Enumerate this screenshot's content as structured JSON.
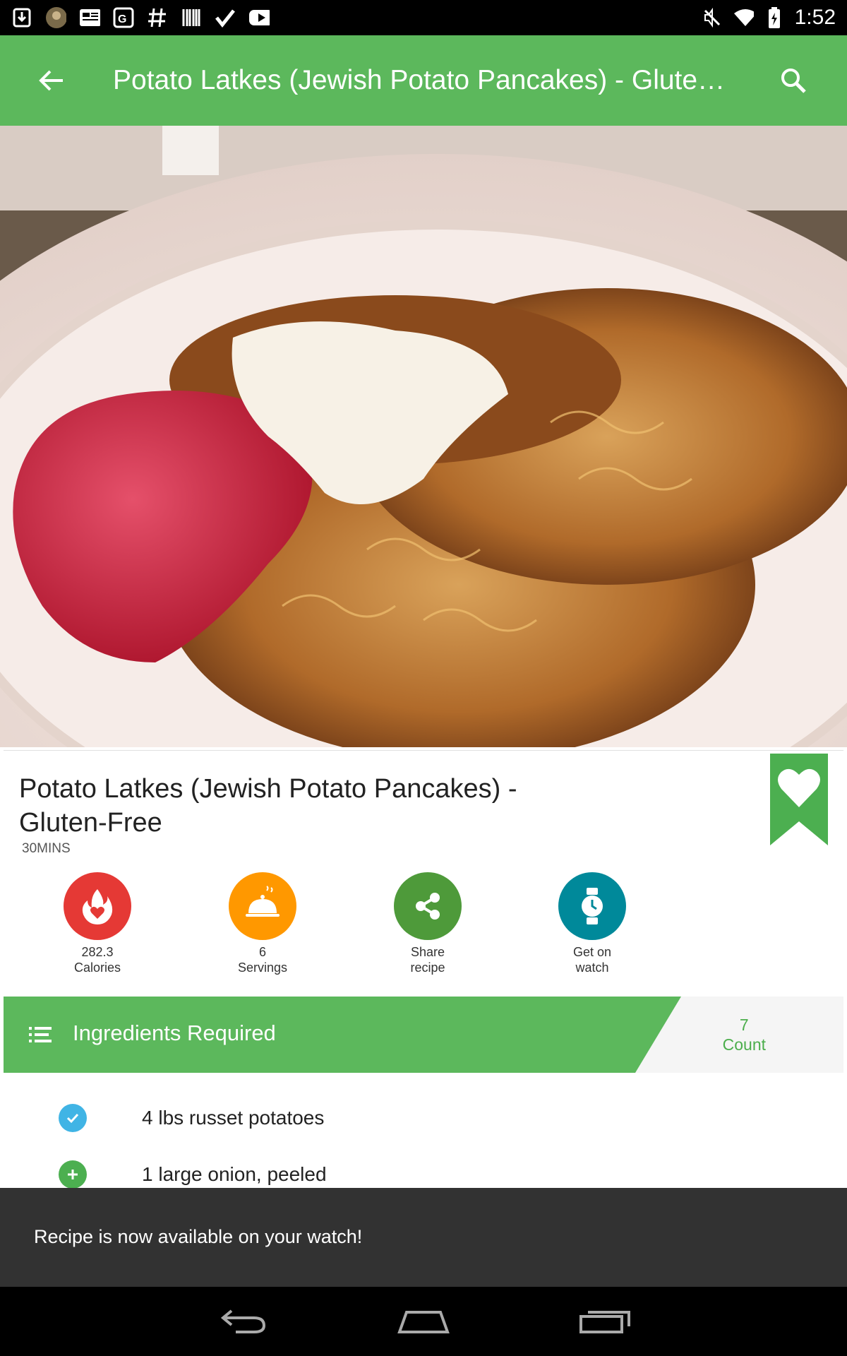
{
  "status_bar": {
    "time": "1:52",
    "left_icons": [
      "download-icon",
      "avatar-icon",
      "news-icon",
      "maps-icon",
      "hashtag-icon",
      "barcode-icon",
      "checkmark-icon",
      "youtube-icon"
    ],
    "right_icons": [
      "mute-icon",
      "wifi-icon",
      "battery-icon"
    ]
  },
  "app_bar": {
    "title": "Potato Latkes (Jewish Potato Pancakes) - Glute…",
    "back_icon": "arrow-back-icon",
    "search_icon": "search-icon",
    "color": "#5cb85c"
  },
  "recipe": {
    "title": "Potato Latkes (Jewish Potato Pancakes) - Gluten-Free",
    "time": "30MINS",
    "favorite_icon": "heart-bookmark-icon"
  },
  "stats": [
    {
      "value": "282.3",
      "label": "Calories",
      "icon": "flame-heart-icon",
      "color": "#e53935"
    },
    {
      "value": "6",
      "label": "Servings",
      "icon": "cloche-icon",
      "color": "#ff9800"
    },
    {
      "value": "Share",
      "label": "recipe",
      "icon": "share-icon",
      "color": "#4e9a3a"
    },
    {
      "value": "Get on",
      "label": "watch",
      "icon": "watch-icon",
      "color": "#00899a"
    }
  ],
  "ingredients": {
    "header": "Ingredients Required",
    "count_value": "7",
    "count_label": "Count",
    "items": [
      {
        "text": "4 lbs russet potatoes",
        "state": "checked"
      },
      {
        "text": "1 large onion, peeled",
        "state": "add"
      }
    ]
  },
  "snackbar": {
    "message": "Recipe is now available on your watch!"
  },
  "nav_bar": {
    "buttons": [
      "back-nav-icon",
      "home-nav-icon",
      "recents-nav-icon"
    ]
  }
}
